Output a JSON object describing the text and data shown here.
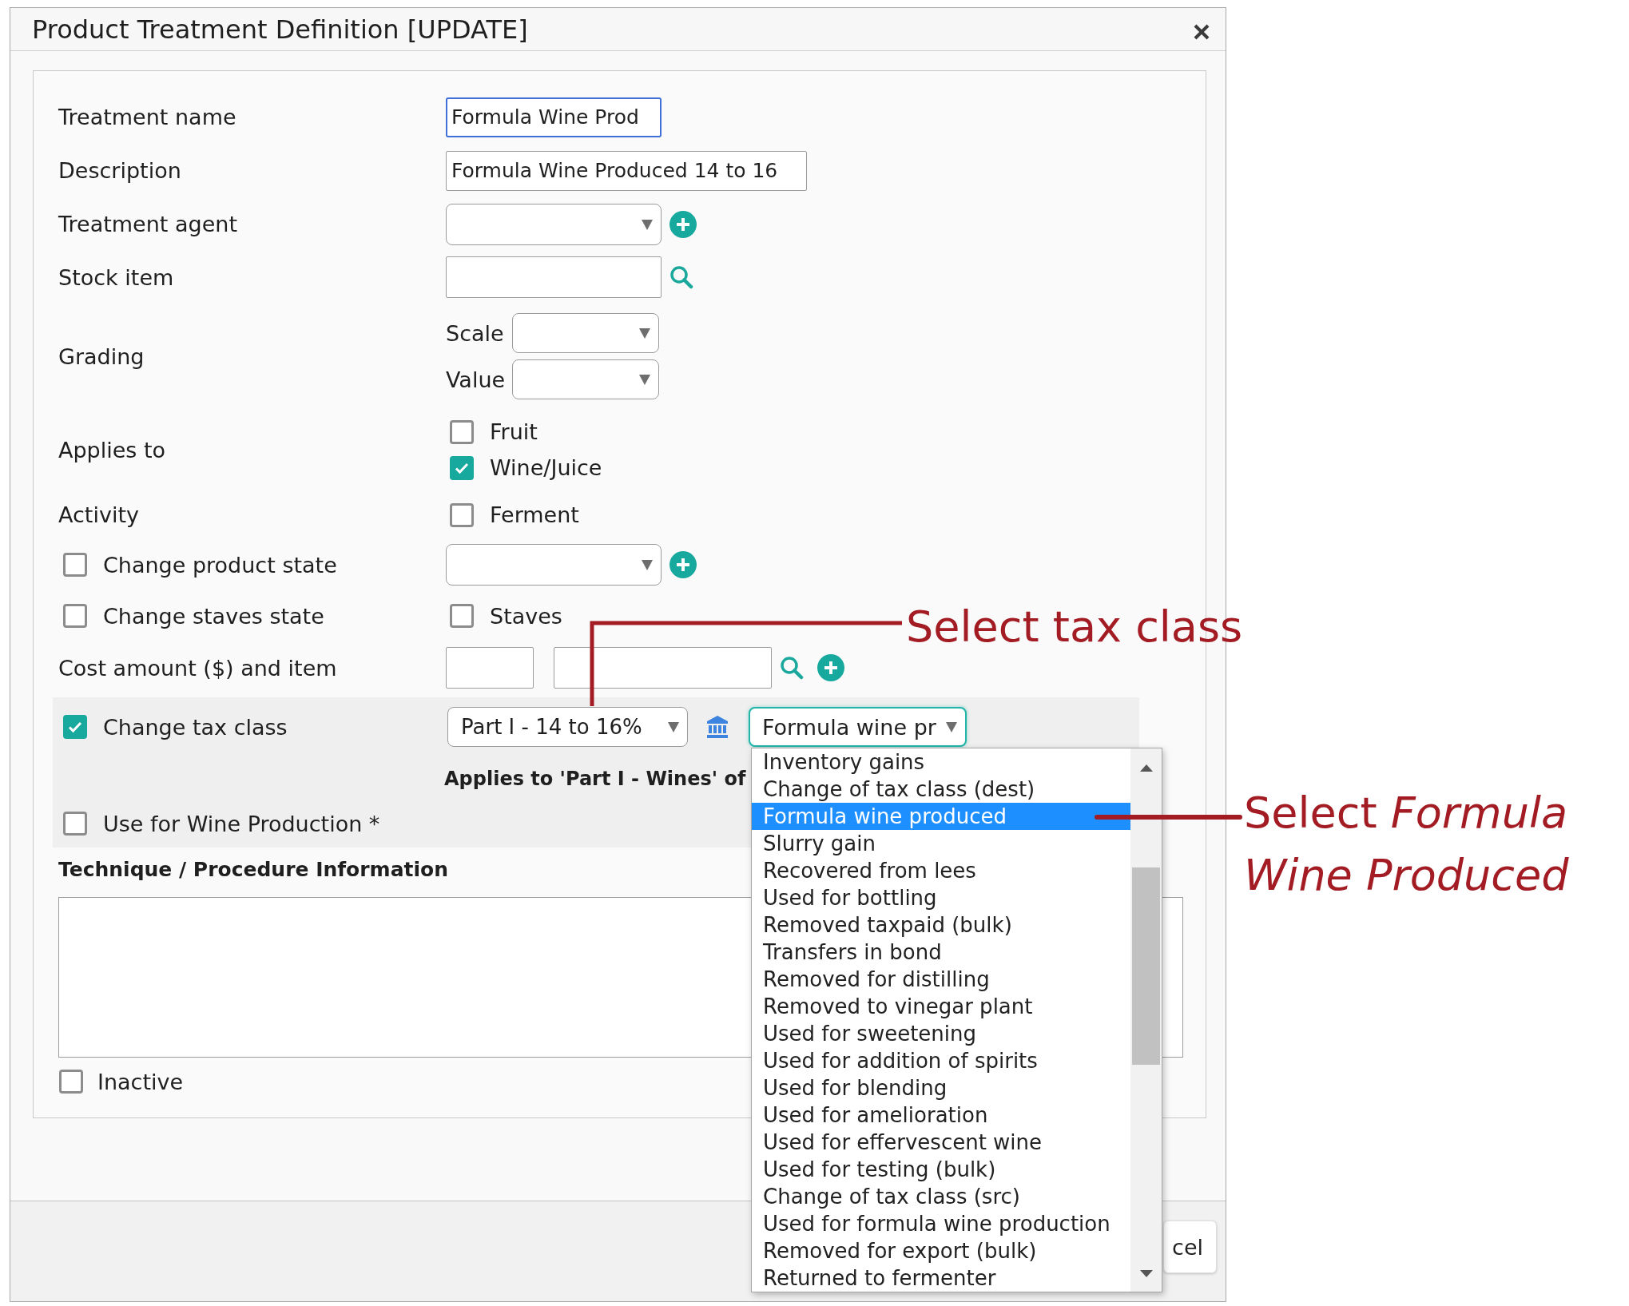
{
  "dialog": {
    "title": "Product Treatment Definition [UPDATE]"
  },
  "fields": [
    {
      "kind": "text",
      "label": "Treatment name",
      "value": "Formula Wine Prod",
      "focused": true
    },
    {
      "kind": "long_text",
      "label": "Description",
      "value": "Formula Wine Produced 14 to 16",
      "focused": false
    },
    {
      "kind": "select_add",
      "label": "Treatment agent"
    },
    {
      "kind": "lookup",
      "label": "Stock item"
    },
    {
      "kind": "grading",
      "label": "Grading",
      "selects": [
        {
          "label": "Scale"
        },
        {
          "label": "Value"
        }
      ]
    },
    {
      "kind": "checks",
      "label": "Applies to",
      "options": [
        {
          "label": "Fruit",
          "checked": false
        },
        {
          "label": "Wine/Juice",
          "checked": true
        }
      ]
    },
    {
      "kind": "checks",
      "label": "Activity",
      "options": [
        {
          "label": "Ferment",
          "checked": false
        }
      ]
    },
    {
      "kind": "check_select",
      "label": "Change product state",
      "checked": false
    },
    {
      "kind": "check_checks",
      "label": "Change staves state",
      "checked": false,
      "options": [
        {
          "label": "Staves",
          "checked": false
        }
      ]
    },
    {
      "kind": "cost",
      "label": "Cost amount ($) and item"
    }
  ],
  "tax_section": {
    "label": "Change tax class",
    "checked": true,
    "tax_class": "Part I - 14 to 16%",
    "subclass": {
      "value": "Formula wine pr",
      "open": true,
      "options": [
        {
          "label": "Inventory gains",
          "selected": false
        },
        {
          "label": "Change of tax class (dest)",
          "selected": false
        },
        {
          "label": "Formula wine produced",
          "selected": true
        },
        {
          "label": "Slurry gain",
          "selected": false
        },
        {
          "label": "Recovered from lees",
          "selected": false
        },
        {
          "label": "Used for bottling",
          "selected": false
        },
        {
          "label": "Removed taxpaid (bulk)",
          "selected": false
        },
        {
          "label": "Transfers in bond",
          "selected": false
        },
        {
          "label": "Removed for distilling",
          "selected": false
        },
        {
          "label": "Removed to vinegar plant",
          "selected": false
        },
        {
          "label": "Used for sweetening",
          "selected": false
        },
        {
          "label": "Used for addition of spirits",
          "selected": false
        },
        {
          "label": "Used for blending",
          "selected": false
        },
        {
          "label": "Used for amelioration",
          "selected": false
        },
        {
          "label": "Used for effervescent wine",
          "selected": false
        },
        {
          "label": "Used for testing (bulk)",
          "selected": false
        },
        {
          "label": "Change of tax class (src)",
          "selected": false
        },
        {
          "label": "Used for formula wine production",
          "selected": false
        },
        {
          "label": "Removed for export (bulk)",
          "selected": false
        },
        {
          "label": "Returned to fermenter",
          "selected": false
        }
      ]
    },
    "note": "Applies to 'Part I - Wines' of",
    "wine_production": {
      "label": "Use for Wine Production *",
      "checked": false
    }
  },
  "technique": {
    "heading": "Technique / Procedure Information"
  },
  "inactive": {
    "label": "Inactive",
    "checked": false
  },
  "footer": {
    "button": "cel"
  },
  "annotations": [
    {
      "text": "Select tax class"
    },
    {
      "text": "Select *Formula Wine Produced*"
    }
  ]
}
